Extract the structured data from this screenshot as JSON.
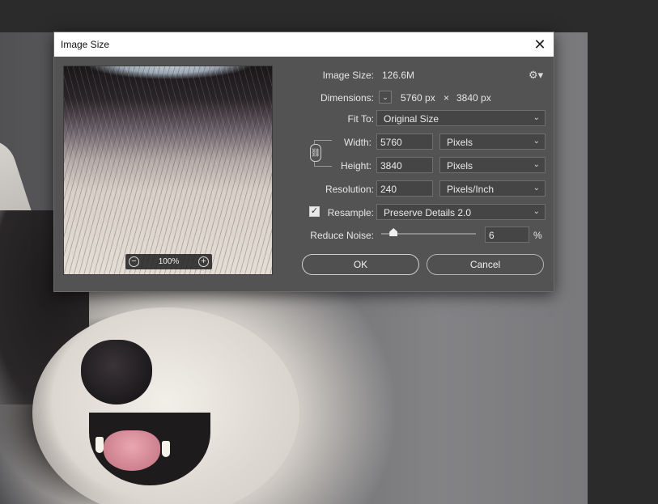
{
  "dialog": {
    "title": "Image Size",
    "close_glyph": "✕"
  },
  "preview": {
    "zoom_out_glyph": "−",
    "zoom_in_glyph": "+",
    "zoom_level": "100%"
  },
  "image_size": {
    "label": "Image Size:",
    "value": "126.6M",
    "settings_icon": "gear-icon"
  },
  "dimensions": {
    "label": "Dimensions:",
    "width": "5760 px",
    "times": "×",
    "height": "3840 px"
  },
  "fit_to": {
    "label": "Fit To:",
    "value": "Original Size"
  },
  "width": {
    "label": "Width:",
    "value": "5760",
    "unit": "Pixels"
  },
  "height": {
    "label": "Height:",
    "value": "3840",
    "unit": "Pixels"
  },
  "resolution": {
    "label": "Resolution:",
    "value": "240",
    "unit": "Pixels/Inch"
  },
  "resample": {
    "label": "Resample:",
    "checked": true,
    "value": "Preserve Details 2.0"
  },
  "reduce_noise": {
    "label": "Reduce Noise:",
    "value": "6",
    "unit": "%",
    "fraction": 0.06
  },
  "buttons": {
    "ok": "OK",
    "cancel": "Cancel"
  },
  "colors": {
    "dialog_bg": "#535353",
    "title_bg": "#ffffff",
    "field_bg": "#454545"
  }
}
